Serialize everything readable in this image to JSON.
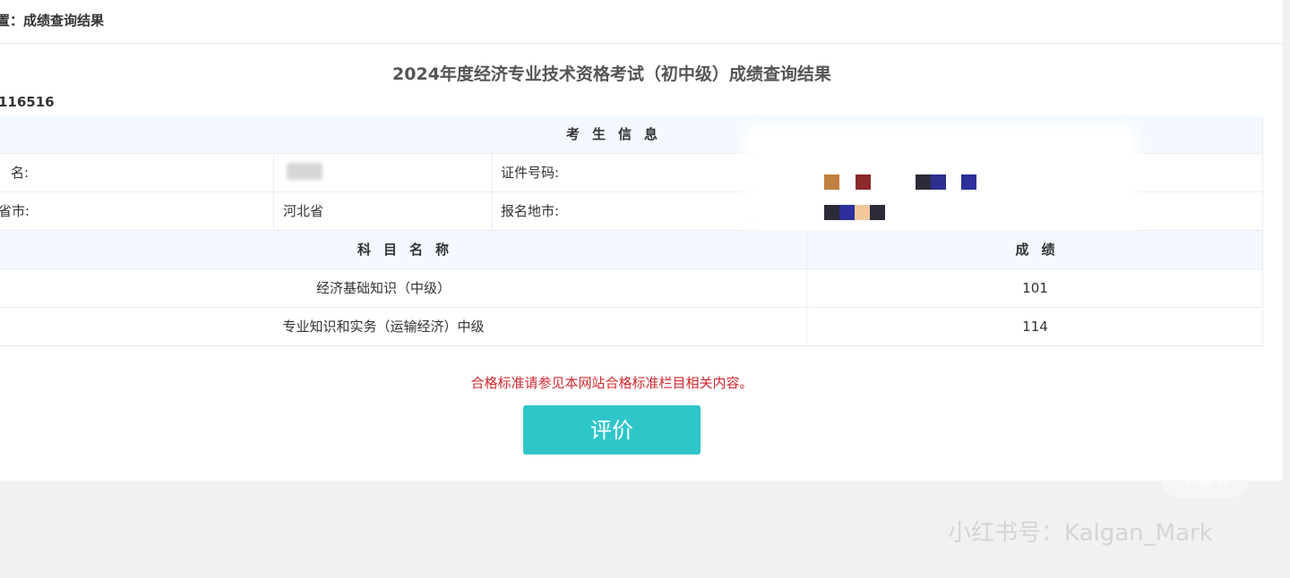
{
  "breadcrumb": "置：成绩查询结果",
  "title": "2024年度经济专业技术资格考试（初中级）成绩查询结果",
  "serial": "116516",
  "candidate_section": {
    "header": "考生信息",
    "name_label": "名:",
    "id_label": "证件号码:",
    "province_label": "省市:",
    "province_value": "河北省",
    "city_label": "报名地市:"
  },
  "scores": {
    "subject_header": "科目名称",
    "score_header": "成绩",
    "rows": [
      {
        "subject": "经济基础知识（中级）",
        "score": "101"
      },
      {
        "subject": "专业知识和实务（运输经济）中级",
        "score": "114"
      }
    ]
  },
  "notice": "合格标准请参见本网站合格标准栏目相关内容。",
  "evaluate_button": "评价",
  "watermark": {
    "logo": "小红书",
    "text": "小红书号：Kalgan_Mark"
  },
  "colors": {
    "accent": "#2ec6c9",
    "notice": "#d0282f",
    "header_bg": "#f3f9ff"
  }
}
